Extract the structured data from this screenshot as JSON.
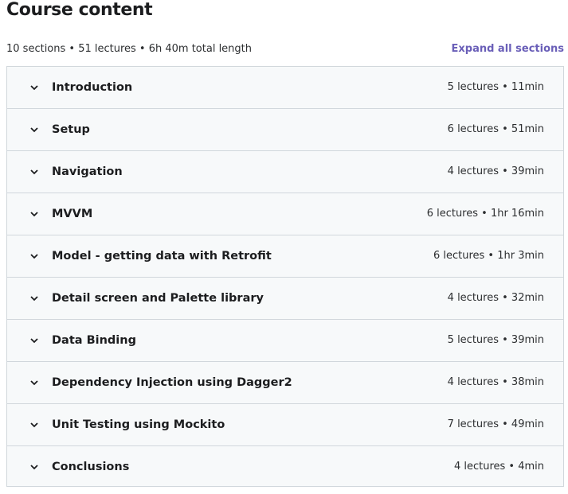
{
  "header": {
    "title": "Course content",
    "meta": "10 sections • 51 lectures • 6h 40m total length",
    "expand_label": "Expand all sections"
  },
  "sections": [
    {
      "title": "Introduction",
      "info": "5 lectures • 11min"
    },
    {
      "title": "Setup",
      "info": "6 lectures • 51min"
    },
    {
      "title": "Navigation",
      "info": "4 lectures • 39min"
    },
    {
      "title": "MVVM",
      "info": "6 lectures • 1hr 16min"
    },
    {
      "title": "Model - getting data with Retrofit",
      "info": "6 lectures • 1hr 3min"
    },
    {
      "title": "Detail screen and Palette library",
      "info": "4 lectures • 32min"
    },
    {
      "title": "Data Binding",
      "info": "5 lectures • 39min"
    },
    {
      "title": "Dependency Injection using Dagger2",
      "info": "4 lectures • 38min"
    },
    {
      "title": "Unit Testing using Mockito",
      "info": "7 lectures • 49min"
    },
    {
      "title": "Conclusions",
      "info": "4 lectures • 4min"
    }
  ],
  "icons": {
    "chevron": "chevron-down-icon"
  },
  "colors": {
    "accent": "#6a5fb8",
    "section_bg": "#f7f9fa",
    "border": "#d1d7dc"
  }
}
